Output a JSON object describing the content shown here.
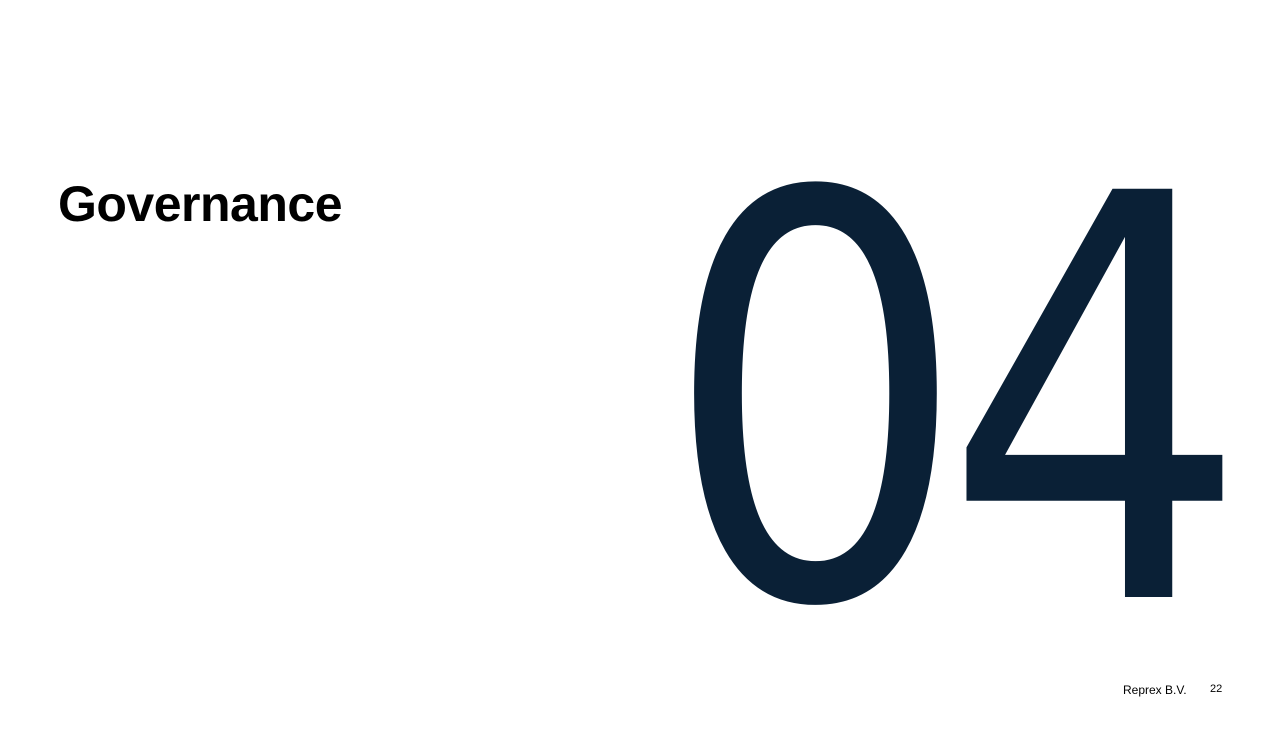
{
  "slide": {
    "title": "Governance",
    "number": "04",
    "number_color": "#0a2036",
    "footer": {
      "company": "Reprex B.V.",
      "page_number": "22"
    }
  }
}
